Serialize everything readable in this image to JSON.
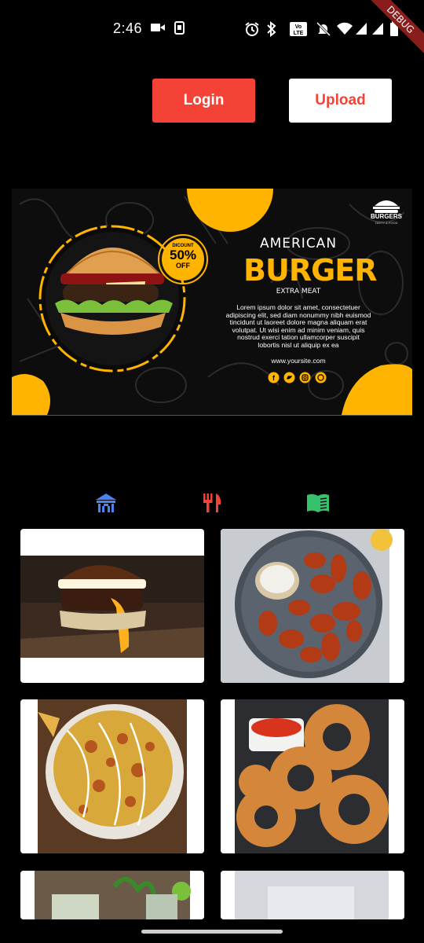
{
  "status_bar": {
    "time": "2:46",
    "icons": [
      "video-camera-icon",
      "sim-icon",
      "alarm-icon",
      "bluetooth-icon",
      "volte-icon",
      "mute-icon",
      "wifi-icon",
      "signal-icon",
      "signal-icon",
      "battery-icon"
    ]
  },
  "debug_banner": "DEBUG",
  "header": {
    "login_label": "Login",
    "upload_label": "Upload",
    "accent": "#f44336"
  },
  "banner": {
    "brand": "BURGERS",
    "brand_tag": "TASTY & FOOD",
    "discount_label": "DICOUNT",
    "discount_value": "50%",
    "discount_suffix": "OFF",
    "title_top": "AMERICAN",
    "title_main": "BURGER",
    "subtitle": "EXTRA MEAT",
    "body_lines": [
      "Lorem ipsum dolor sit amet, consectetuer",
      "adipiscing elit, sed diam nonummy nibh euismod",
      "tincidunt ut laoreet dolore magna aliquam erat",
      "volutpat. Ut wisi enim ad minim veniam, quis",
      "nostrud exerci tation ullamcorper suscipit",
      "lobortis nisl ut aliquip ex ea"
    ],
    "website": "www.yoursite.com",
    "social_icons": [
      "facebook-icon",
      "twitter-icon",
      "instagram-icon",
      "whatsapp-icon"
    ],
    "yellow": "#ffb400"
  },
  "tabs": [
    {
      "name": "restaurant-icon",
      "color": "#4c83f0"
    },
    {
      "name": "fork-knife-icon",
      "color": "#f44336"
    },
    {
      "name": "menu-book-icon",
      "color": "#35c26a"
    }
  ],
  "grid": [
    {
      "name": "burger-photo"
    },
    {
      "name": "chicken-wings-photo"
    },
    {
      "name": "nachos-photo"
    },
    {
      "name": "onion-rings-photo"
    },
    {
      "name": "mojito-photo"
    },
    {
      "name": "drink-photo"
    }
  ]
}
